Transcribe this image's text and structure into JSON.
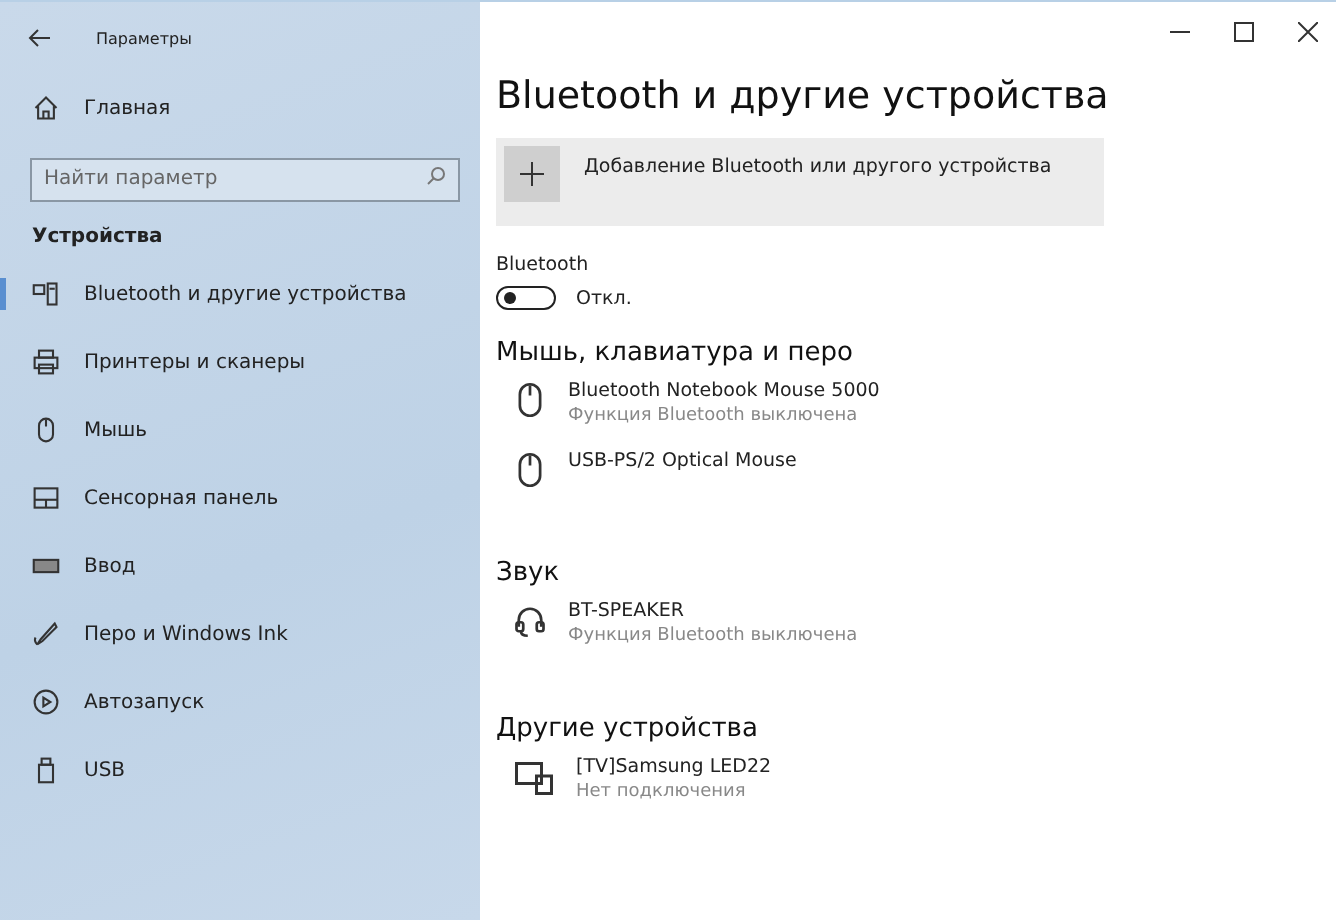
{
  "window": {
    "title": "Параметры"
  },
  "sidebar": {
    "home": "Главная",
    "search": {
      "placeholder": "Найти параметр"
    },
    "section": "Устройства",
    "items": [
      {
        "label": "Bluetooth и другие устройства",
        "kind": "bluetooth",
        "selected": true
      },
      {
        "label": "Принтеры и сканеры",
        "kind": "printer",
        "selected": false
      },
      {
        "label": "Мышь",
        "kind": "mouse",
        "selected": false
      },
      {
        "label": "Сенсорная панель",
        "kind": "touchpad",
        "selected": false
      },
      {
        "label": "Ввод",
        "kind": "keyboard",
        "selected": false
      },
      {
        "label": "Перо и Windows Ink",
        "kind": "pen",
        "selected": false
      },
      {
        "label": "Автозапуск",
        "kind": "autoplay",
        "selected": false
      },
      {
        "label": "USB",
        "kind": "usb",
        "selected": false
      }
    ]
  },
  "main": {
    "title": "Bluetooth и другие устройства",
    "add_button": "Добавление Bluetooth или другого устройства",
    "bluetooth": {
      "label": "Bluetooth",
      "on": false,
      "state": "Откл."
    },
    "groups": [
      {
        "title": "Мышь, клавиатура и перо",
        "devices": [
          {
            "name": "Bluetooth Notebook Mouse 5000",
            "status": "Функция Bluetooth выключена",
            "kind": "mouse"
          },
          {
            "name": "USB-PS/2 Optical Mouse",
            "kind": "mouse"
          }
        ]
      },
      {
        "title": "Звук",
        "devices": [
          {
            "name": "BT-SPEAKER",
            "status": "Функция Bluetooth выключена",
            "kind": "headset"
          }
        ]
      },
      {
        "title": "Другие устройства",
        "devices": [
          {
            "name": "[TV]Samsung LED22",
            "status": "Нет подключения",
            "kind": "display"
          }
        ]
      }
    ]
  }
}
